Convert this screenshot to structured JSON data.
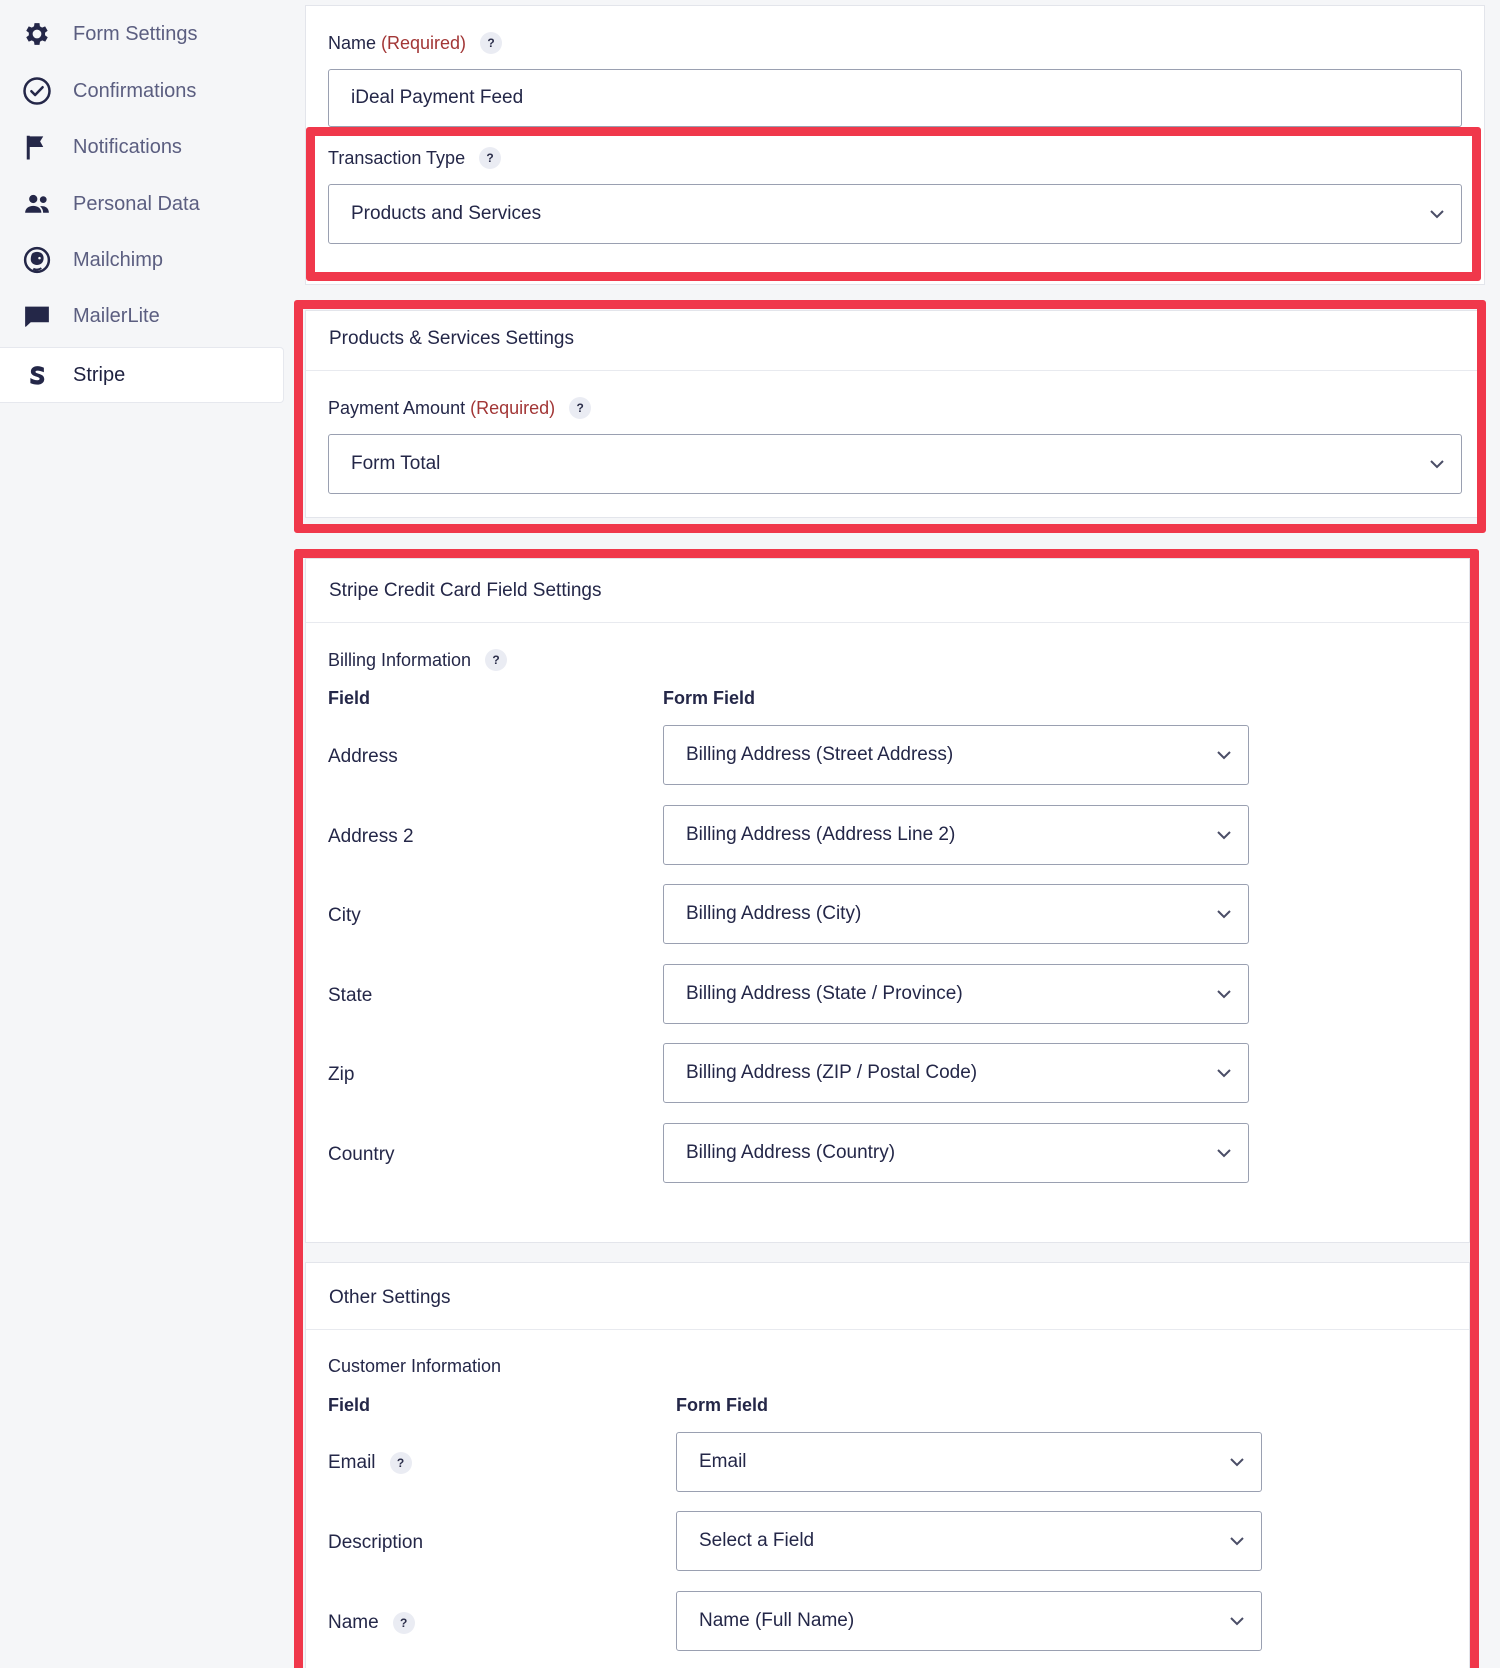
{
  "sidebar": {
    "items": [
      {
        "label": "Form Settings",
        "icon": "gear-icon"
      },
      {
        "label": "Confirmations",
        "icon": "check-circle-icon"
      },
      {
        "label": "Notifications",
        "icon": "flag-icon"
      },
      {
        "label": "Personal Data",
        "icon": "users-icon"
      },
      {
        "label": "Mailchimp",
        "icon": "mailchimp-icon"
      },
      {
        "label": "MailerLite",
        "icon": "chat-bubble-icon"
      },
      {
        "label": "Stripe",
        "icon": "stripe-icon",
        "active": true
      }
    ]
  },
  "feed": {
    "name_label": "Name",
    "name_required": "(Required)",
    "name_value": "iDeal Payment Feed",
    "transaction_type_label": "Transaction Type",
    "transaction_type_value": "Products and Services"
  },
  "products_services": {
    "title": "Products & Services Settings",
    "payment_amount_label": "Payment Amount",
    "payment_amount_required": "(Required)",
    "payment_amount_value": "Form Total"
  },
  "stripe_cc": {
    "title": "Stripe Credit Card Field Settings",
    "billing_label": "Billing Information",
    "col_field": "Field",
    "col_form_field": "Form Field",
    "rows": [
      {
        "field": "Address",
        "value": "Billing Address (Street Address)"
      },
      {
        "field": "Address 2",
        "value": "Billing Address (Address Line 2)"
      },
      {
        "field": "City",
        "value": "Billing Address (City)"
      },
      {
        "field": "State",
        "value": "Billing Address (State / Province)"
      },
      {
        "field": "Zip",
        "value": "Billing Address (ZIP / Postal Code)"
      },
      {
        "field": "Country",
        "value": "Billing Address (Country)"
      }
    ]
  },
  "other": {
    "title": "Other Settings",
    "customer_label": "Customer Information",
    "col_field": "Field",
    "col_form_field": "Form Field",
    "rows": [
      {
        "field": "Email",
        "value": "Email"
      },
      {
        "field": "Description",
        "value": "Select a Field"
      },
      {
        "field": "Name",
        "value": "Name (Full Name)"
      }
    ]
  },
  "help_glyph": "?",
  "colors": {
    "highlight": "#f0384b",
    "required": "#a23636",
    "text": "#242748"
  }
}
